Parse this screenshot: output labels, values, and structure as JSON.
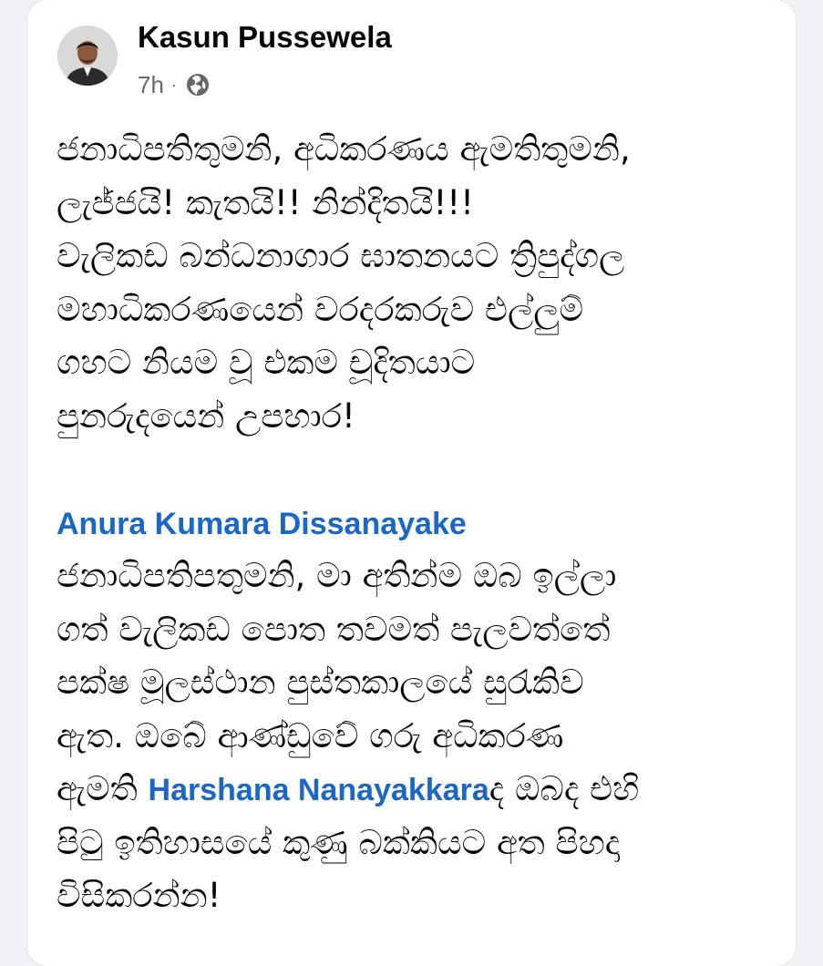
{
  "post": {
    "author_name": "Kasun Pussewela",
    "time_ago": "7h",
    "separator": "·",
    "audience_icon": "globe-icon",
    "paragraph1": [
      "ජනාධිපතිතුමනි, අධිකරණය ඇමතිතුමනි,",
      "ලැජ්ජයි! කැතයි!! නින්දිතයි!!!",
      "වැලිකඩ බන්ධනාගාර ඝාතනයට ත්‍රිපුද්ගල",
      "මහාධිකරණයෙන් වරදරකරුව එල්ලුම්",
      "ගහට නියම වූ එකම චූදිතයාට",
      "පුනරුදයෙන් උපහාර!"
    ],
    "mention1": "Anura Kumara Dissanayake",
    "paragraph2": [
      "ජනාධිපතිපතුමනි, මා අතින්ම ඔබ ඉල්ලා",
      "ගත් වැලිකඩ පොත තවමත් පැලවත්තේ",
      "පක්ෂ මූලස්ථාන පුස්තකාලයේ සුරැකිව",
      "ඇත. ඔබේ ආණ්ඩුවේ ගරු අධිකරණ"
    ],
    "line11_prefix": "ඇමති ",
    "mention2": "Harshana Nanayakkara",
    "line11_suffix": "ද ඔබද එහි",
    "paragraph2_end": [
      "පිටු ඉතිහාසයේ කුණු බක්කියට අත පිහදා",
      "විසිකරන්න!"
    ]
  },
  "colors": {
    "mention": "#1b66c9",
    "text": "#050505",
    "meta": "#65676b"
  }
}
